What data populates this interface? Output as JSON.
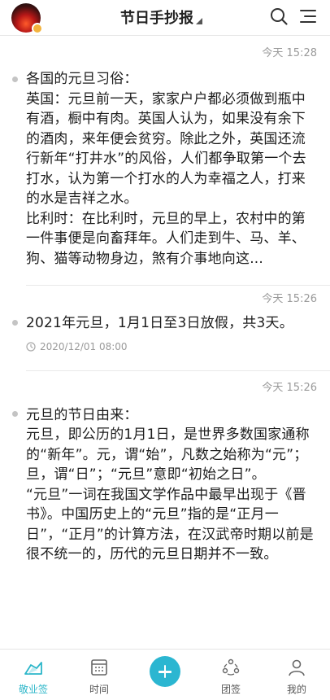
{
  "header": {
    "title": "节日手抄报",
    "avatar_icon": "avatar",
    "search_icon": "search-icon",
    "menu_icon": "menu-icon"
  },
  "entries": [
    {
      "time": "今天 15:28",
      "text": "各国的元旦习俗：\n英国：元旦前一天，家家户户都必须做到瓶中有酒，橱中有肉。英国人认为，如果没有余下的酒肉，来年便会贫穷。除此之外，英国还流行新年“打井水”的风俗，人们都争取第一个去打水，认为第一个打水的人为幸福之人，打来的水是吉祥之水。\n比利时：在比利时，元旦的早上，农村中的第一件事便是向畜拜年。人们走到牛、马、羊、狗、猫等动物身边，煞有介事地向这..."
    },
    {
      "time": "今天 15:26",
      "text": "2021年元旦，1月1日至3日放假，共3天。",
      "reminder": "2020/12/01 08:00"
    },
    {
      "time": "今天 15:26",
      "text": "元旦的节日由来：\n元旦，即公历的1月1日，是世界多数国家通称的“新年”。元，谓“始”，凡数之始称为“元”；旦，谓“日”；“元旦”意即“初始之日”。\n“元旦”一词在我国文学作品中最早出现于《晋书》。中国历史上的“元旦”指的是“正月一日”，“正月”的计算方法，在汉武帝时期以前是很不统一的，历代的元旦日期并不一致。"
    }
  ],
  "tabbar": {
    "tabs": [
      {
        "label": "敬业签",
        "icon": "note-icon",
        "active": true
      },
      {
        "label": "时间",
        "icon": "calendar-icon",
        "active": false
      },
      {
        "label": "团签",
        "icon": "group-icon",
        "active": false
      },
      {
        "label": "我的",
        "icon": "profile-icon",
        "active": false
      }
    ],
    "add_icon": "plus-icon"
  },
  "colors": {
    "accent": "#2bb6d1",
    "text": "#1c1c1c",
    "muted": "#9a9a9a"
  }
}
